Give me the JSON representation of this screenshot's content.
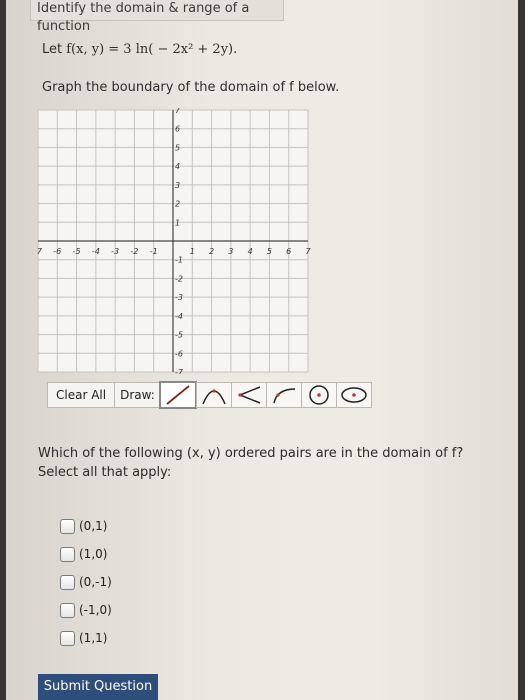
{
  "header": {
    "title": "Identify the domain & range of a function"
  },
  "problem": {
    "prefix": "Let",
    "function_text": "f(x, y) = 3 ln( − 2x² + 2y).",
    "instruction": "Graph the boundary of the domain of f below."
  },
  "graph": {
    "x_ticks": [
      "-7",
      "-6",
      "-5",
      "-4",
      "-3",
      "-2",
      "-1",
      "1",
      "2",
      "3",
      "4",
      "5",
      "6",
      "7"
    ],
    "y_ticks": [
      "7",
      "6",
      "5",
      "4",
      "3",
      "2",
      "1",
      "-1",
      "-2",
      "-3",
      "-4",
      "-5",
      "-6",
      "-7"
    ],
    "xlim": [
      -7,
      7
    ],
    "ylim": [
      -7,
      7
    ]
  },
  "toolbar": {
    "clear_label": "Clear All",
    "draw_label": "Draw:",
    "tools": [
      "line-tool-icon",
      "parabola-tool-icon",
      "angle-tool-icon",
      "curve-tool-icon",
      "circle-tool-icon",
      "ellipse-tool-icon"
    ]
  },
  "question": {
    "text": "Which of the following (x, y) ordered pairs are in the domain of f? Select all that apply:"
  },
  "options": [
    "(0,1)",
    "(1,0)",
    "(0,-1)",
    "(-1,0)",
    "(1,1)"
  ],
  "submit": {
    "label": "Submit Question"
  },
  "colors": {
    "submit_bg": "#2e4d7a",
    "tool_red": "#c0392b"
  }
}
